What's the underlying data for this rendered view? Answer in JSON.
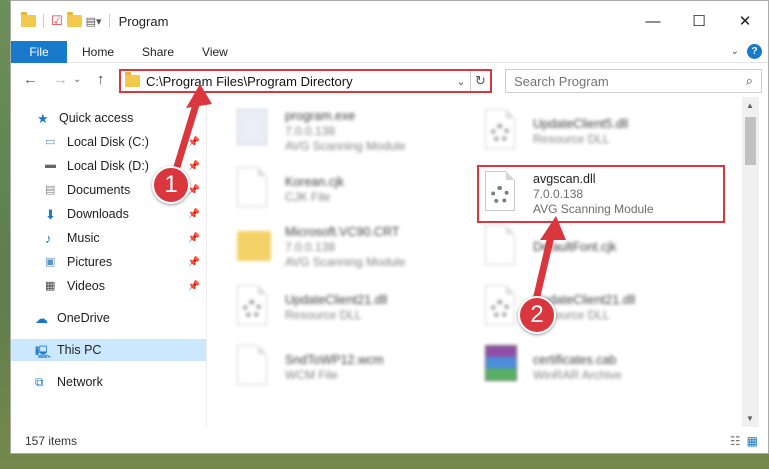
{
  "window": {
    "title": "Program"
  },
  "ribbon": {
    "tabs": [
      "File",
      "Home",
      "Share",
      "View"
    ],
    "help": "?"
  },
  "nav": {
    "back": "←",
    "forward": "→",
    "up": "↑",
    "address": "C:\\Program Files\\Program Directory",
    "search_placeholder": "Search Program"
  },
  "sidebar": {
    "items": [
      {
        "label": "Quick access",
        "icon": "star-icon"
      },
      {
        "label": "Local Disk (C:)",
        "icon": "disk-icon",
        "pinned": true
      },
      {
        "label": "Local Disk (D:)",
        "icon": "disk-icon",
        "pinned": true
      },
      {
        "label": "Documents",
        "icon": "documents-icon",
        "pinned": true
      },
      {
        "label": "Downloads",
        "icon": "download-icon",
        "pinned": true
      },
      {
        "label": "Music",
        "icon": "music-icon",
        "pinned": true
      },
      {
        "label": "Pictures",
        "icon": "pictures-icon",
        "pinned": true
      },
      {
        "label": "Videos",
        "icon": "videos-icon",
        "pinned": true
      },
      {
        "label": "OneDrive",
        "icon": "cloud-icon"
      },
      {
        "label": "This PC",
        "icon": "computer-icon",
        "selected": true
      },
      {
        "label": "Network",
        "icon": "network-icon"
      }
    ]
  },
  "files": [
    {
      "name": "program.exe",
      "sub1": "7.0.0.138",
      "sub2": "AVG Scanning Module",
      "icon": "exe-icon"
    },
    {
      "name": "UpdateClient5.dll",
      "sub1": "Resource DLL",
      "sub2": "",
      "icon": "dll-icon"
    },
    {
      "name": "Korean.cjk",
      "sub1": "CJK File",
      "sub2": "",
      "icon": "file-icon"
    },
    {
      "name": "avgscan.dll",
      "sub1": "7.0.0.138",
      "sub2": "AVG Scanning Module",
      "icon": "dll-icon"
    },
    {
      "name": "Microsoft.VC90.CRT",
      "sub1": "7.0.0.138",
      "sub2": "AVG Scanning Module",
      "icon": "folder-icon"
    },
    {
      "name": "DefaultFont.cjk",
      "sub1": "",
      "sub2": "",
      "icon": "file-icon"
    },
    {
      "name": "UpdateClient21.dll",
      "sub1": "Resource DLL",
      "sub2": "",
      "icon": "dll-icon"
    },
    {
      "name": "UpdateClient21.dll",
      "sub1": "Resource DLL",
      "sub2": "",
      "icon": "dll-icon"
    },
    {
      "name": "SndToWP12.wcm",
      "sub1": "WCM File",
      "sub2": "",
      "icon": "file-icon"
    },
    {
      "name": "certificates.cab",
      "sub1": "WinRAR Archive",
      "sub2": "",
      "icon": "archive-icon"
    }
  ],
  "status": {
    "count": "157 items"
  },
  "annotations": {
    "step1": "1",
    "step2": "2",
    "color": "#d9363e"
  }
}
